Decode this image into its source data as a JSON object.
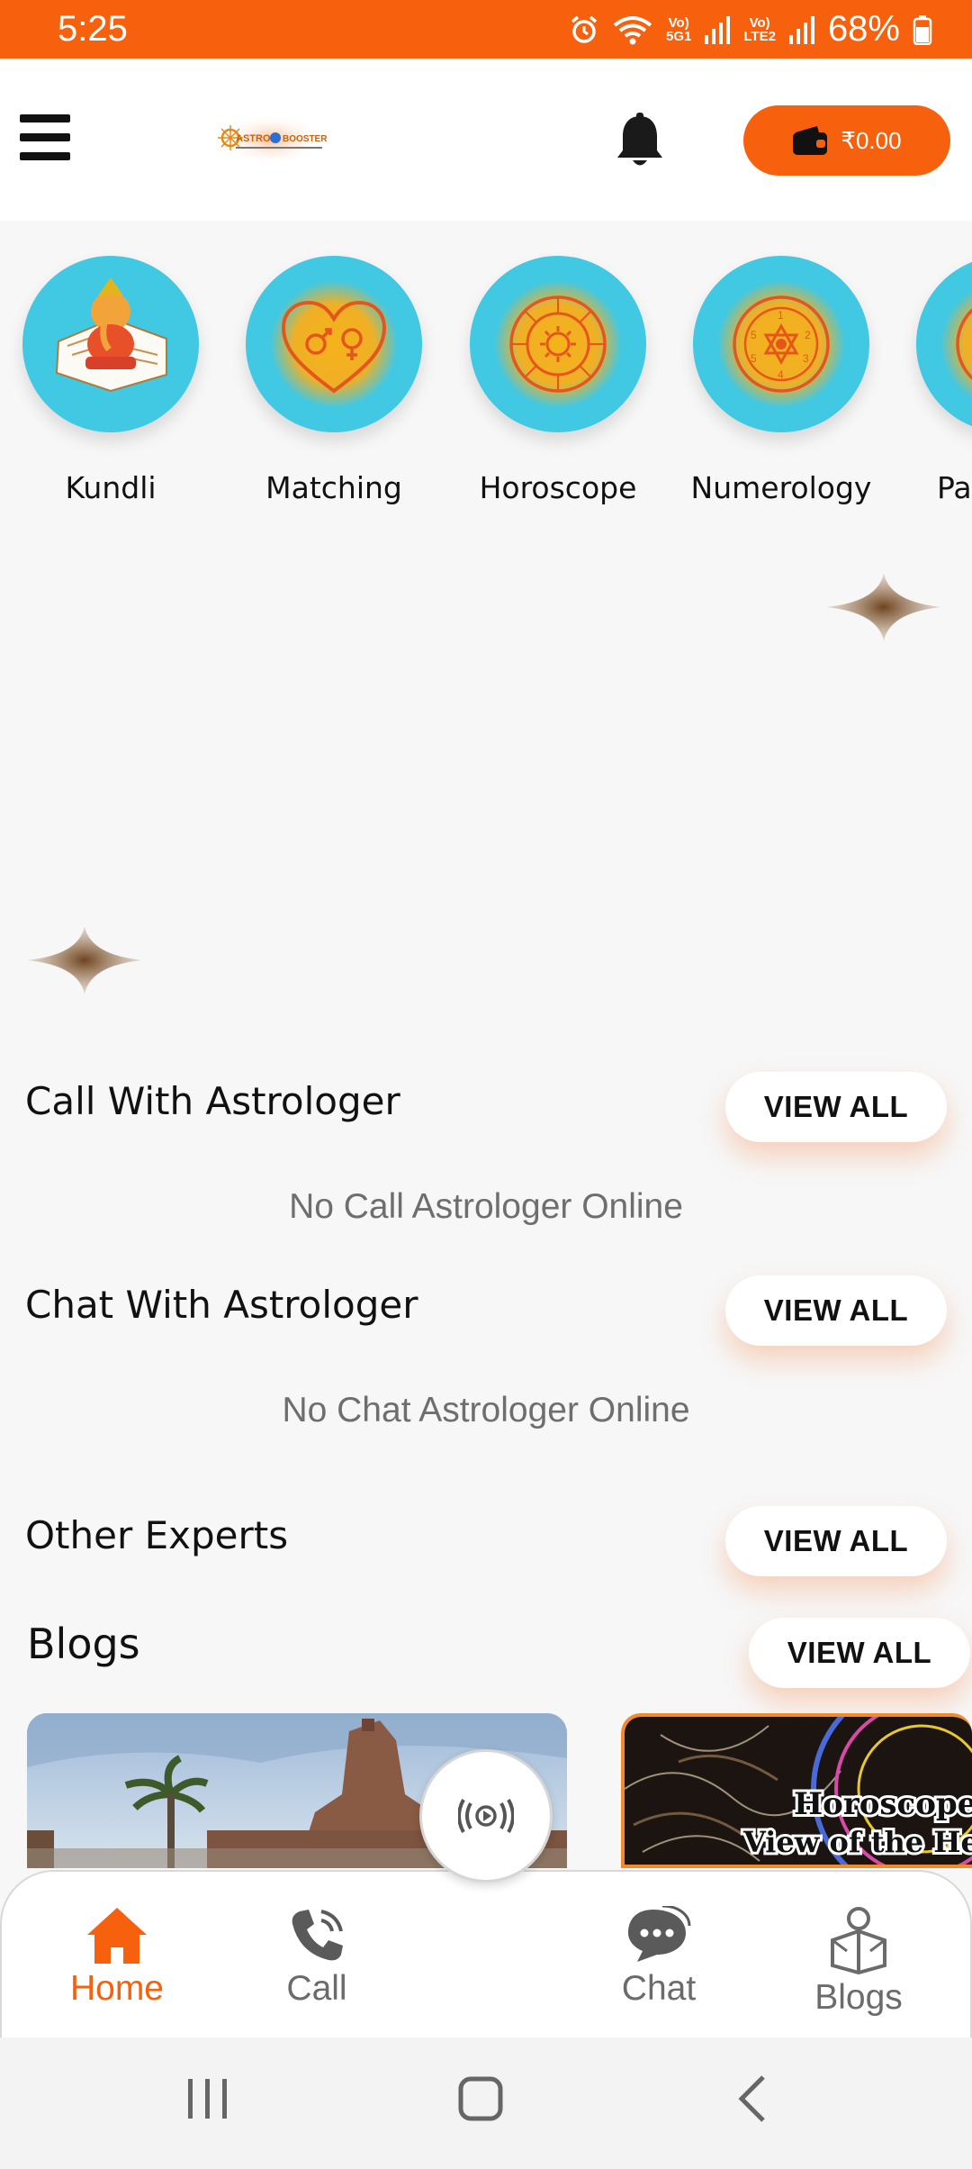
{
  "status_bar": {
    "time": "5:25",
    "net1_top": "Vo)",
    "net1_bottom": "5G1",
    "net2_top": "Vo)",
    "net2_bottom": "LTE2",
    "battery": "68%"
  },
  "header": {
    "logo_alt": "ASTRO BOOSTER",
    "wallet_balance": "₹0.00"
  },
  "categories": [
    {
      "label": "Kundli",
      "icon": "ganesha-kundli-icon"
    },
    {
      "label": "Matching",
      "icon": "heart-gender-icon"
    },
    {
      "label": "Horoscope",
      "icon": "zodiac-wheel-icon"
    },
    {
      "label": "Numerology",
      "icon": "numerology-wheel-icon"
    },
    {
      "label": "Pa",
      "icon": "panchang-icon"
    }
  ],
  "sections": {
    "call": {
      "title": "Call With Astrologer",
      "view_all": "VIEW ALL",
      "empty": "No Call Astrologer Online"
    },
    "chat": {
      "title": "Chat With Astrologer",
      "view_all": "VIEW ALL",
      "empty": "No Chat Astrologer Online"
    },
    "experts": {
      "title": "Other Experts",
      "view_all": "VIEW ALL"
    },
    "blogs": {
      "title": "Blogs",
      "view_all": "VIEW ALL",
      "cards": [
        {
          "overlay_line1": "",
          "overlay_line2": ""
        },
        {
          "overlay_line1": "Horoscope",
          "overlay_line2": "View of the He"
        }
      ]
    }
  },
  "bottom_nav": {
    "items": [
      {
        "label": "Home",
        "icon": "home-icon",
        "active": true
      },
      {
        "label": "Call",
        "icon": "phone-icon",
        "active": false
      },
      {
        "label": "Chat",
        "icon": "chat-bubble-icon",
        "active": false
      },
      {
        "label": "Blogs",
        "icon": "blog-reader-icon",
        "active": false
      }
    ]
  },
  "colors": {
    "accent": "#f7600c",
    "category_bg": "#41c8e3",
    "category_glow": "#f5b21a",
    "sparkle": "#7a5230"
  }
}
